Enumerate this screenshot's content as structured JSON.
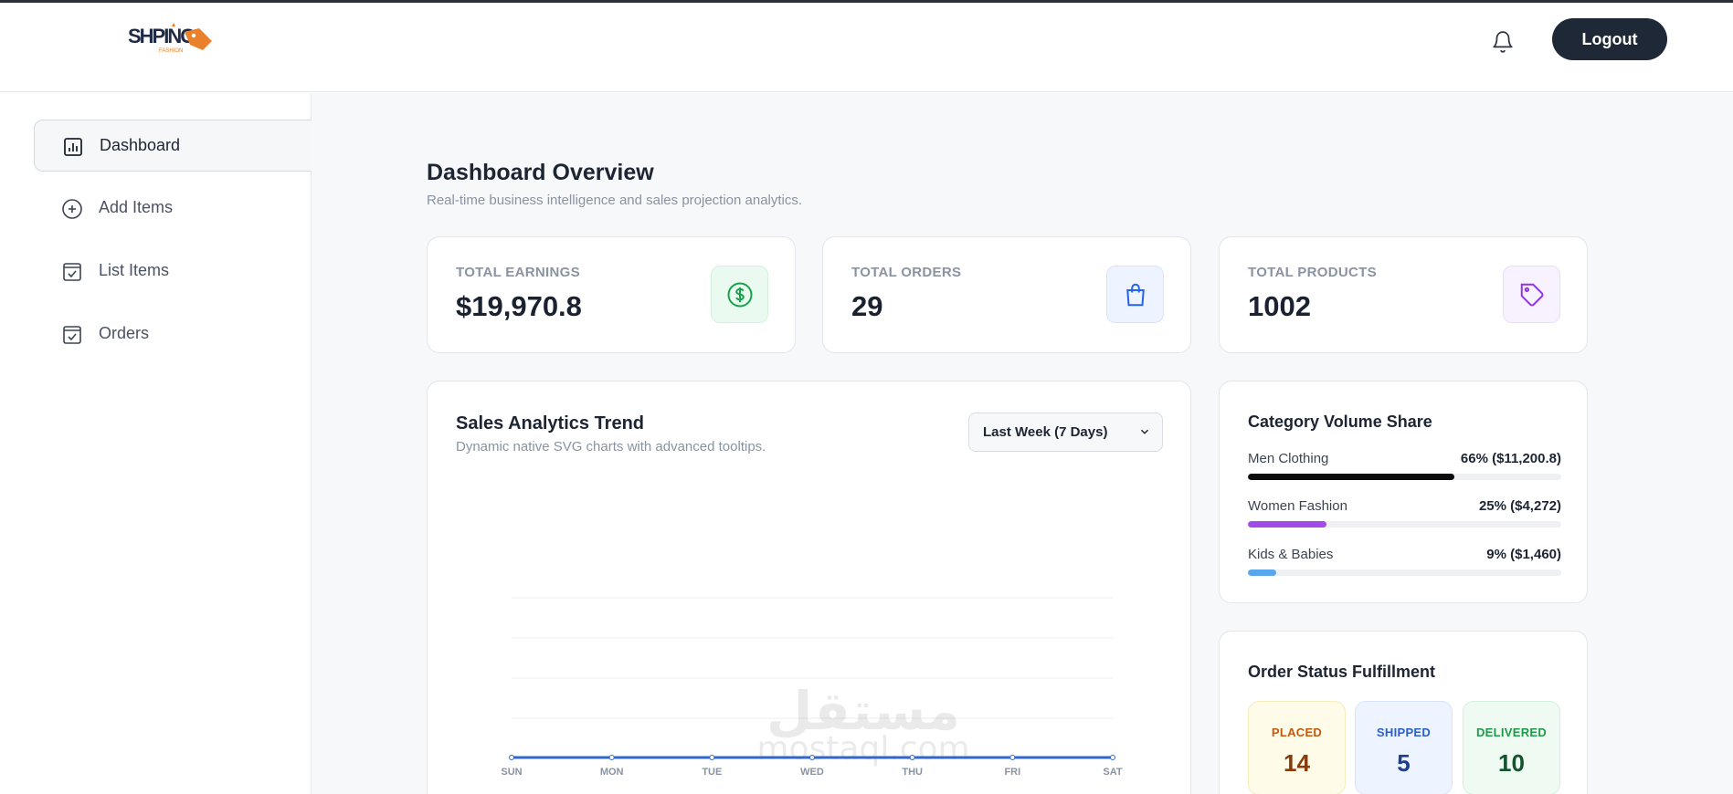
{
  "header": {
    "logo_text": "SHPING",
    "logo_sub": "FASHION",
    "logout_label": "Logout",
    "bell_icon": "bell-icon"
  },
  "sidebar": {
    "items": [
      {
        "label": "Dashboard",
        "icon": "bar-chart-icon",
        "active": true
      },
      {
        "label": "Add Items",
        "icon": "plus-circle-icon",
        "active": false
      },
      {
        "label": "List Items",
        "icon": "checkbox-icon",
        "active": false
      },
      {
        "label": "Orders",
        "icon": "checkbox-icon",
        "active": false
      }
    ]
  },
  "overview": {
    "title": "Dashboard Overview",
    "subtitle": "Real-time business intelligence and sales projection analytics."
  },
  "stats": [
    {
      "label": "TOTAL EARNINGS",
      "value": "$19,970.8",
      "icon": "dollar-icon",
      "color": "#16a34a",
      "bg": "#eafaf0"
    },
    {
      "label": "TOTAL ORDERS",
      "value": "29",
      "icon": "shopping-bag-icon",
      "color": "#2563eb",
      "bg": "#edf4ff"
    },
    {
      "label": "TOTAL PRODUCTS",
      "value": "1002",
      "icon": "tag-icon",
      "color": "#9333ea",
      "bg": "#f8f1ff"
    }
  ],
  "sales_chart": {
    "title": "Sales Analytics Trend",
    "subtitle": "Dynamic native SVG charts with advanced tooltips.",
    "range_selected": "Last Week (7 Days)"
  },
  "chart_data": {
    "type": "line",
    "categories": [
      "SUN",
      "MON",
      "TUE",
      "WED",
      "THU",
      "FRI",
      "SAT"
    ],
    "values": [
      0,
      0,
      0,
      0,
      0,
      0,
      0
    ],
    "title": "",
    "xlabel": "",
    "ylabel": "",
    "grid": true,
    "line_color": "#2f66d0"
  },
  "category_share": {
    "title": "Category Volume Share",
    "items": [
      {
        "name": "Men Clothing",
        "value": "66% ($11,200.8)",
        "percent": 66,
        "color": "#0b0b0b"
      },
      {
        "name": "Women Fashion",
        "value": "25% ($4,272)",
        "percent": 25,
        "color": "#a24be8"
      },
      {
        "name": "Kids & Babies",
        "value": "9% ($1,460)",
        "percent": 9,
        "color": "#58a6ec"
      }
    ]
  },
  "order_status": {
    "title": "Order Status Fulfillment",
    "items": [
      {
        "label": "PLACED",
        "count": "14",
        "color": "#c2590f",
        "numcolor": "#8a3b0b",
        "bg": "#fefbe9",
        "border": "#f6ecbc"
      },
      {
        "label": "SHIPPED",
        "count": "5",
        "color": "#2a5fc7",
        "numcolor": "#1e3d8f",
        "bg": "#eef4ff",
        "border": "#d6e3fb"
      },
      {
        "label": "DELIVERED",
        "count": "10",
        "color": "#1f9a4a",
        "numcolor": "#14532d",
        "bg": "#effbf2",
        "border": "#d3f1dc"
      }
    ]
  },
  "watermark": {
    "arabic": "مستقل",
    "latin": "mostaql.com"
  }
}
